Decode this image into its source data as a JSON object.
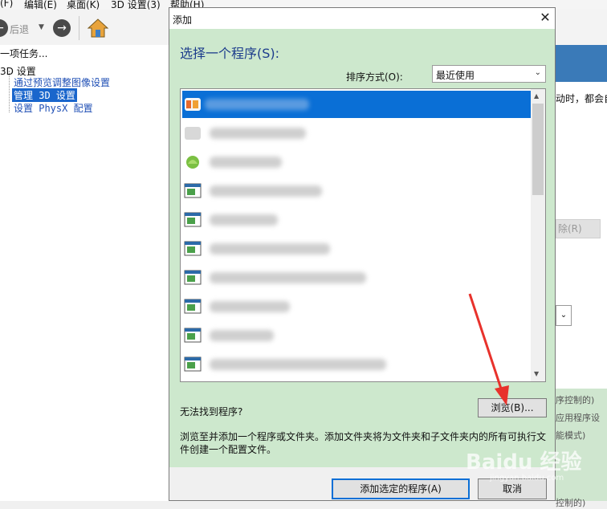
{
  "menubar": {
    "items": [
      "(F)",
      "编辑(E)",
      "桌面(K)",
      "3D 设置(3)",
      "帮助(H)"
    ]
  },
  "toolbar": {
    "back_label": "后退",
    "back_icon": "back-arrow-icon",
    "forward_icon": "forward-arrow-icon",
    "home_icon": "home-icon"
  },
  "task_panel": {
    "header": "一项任务..."
  },
  "tree": {
    "root": "3D 设置",
    "items": [
      "通过预览调整图像设置",
      "管理 3D 设置",
      "设置 PhysX 配置"
    ]
  },
  "right_panel": {
    "text1": "动时，都会自",
    "remove_button": "除(R)",
    "lines": [
      "序控制的)",
      "应用程序设",
      "能模式)",
      "控制的)"
    ]
  },
  "dialog": {
    "title": "添加",
    "heading": "选择一个程序(S):",
    "sort_label": "排序方式(O):",
    "sort_value": "最近使用",
    "not_found": "无法找到程序?",
    "browse_button": "浏览(B)...",
    "description": "浏览至并添加一个程序或文件夹。添加文件夹将为文件夹和子文件夹内的所有可执行文件创建一个配置文件。",
    "add_button": "添加选定的程序(A)",
    "cancel_button": "取消",
    "programs": [
      {
        "name": "",
        "icon": "app-icon-orange",
        "selected": true
      },
      {
        "name": "",
        "icon": "app-icon-blurred",
        "selected": false
      },
      {
        "name": "",
        "icon": "app-icon-green",
        "selected": false
      },
      {
        "name": "",
        "icon": "program-window-icon",
        "selected": false
      },
      {
        "name": "",
        "icon": "program-window-icon",
        "selected": false
      },
      {
        "name": "",
        "icon": "program-window-icon",
        "selected": false
      },
      {
        "name": "",
        "icon": "program-window-icon",
        "selected": false
      },
      {
        "name": "",
        "icon": "program-window-icon",
        "selected": false
      },
      {
        "name": "",
        "icon": "program-window-icon",
        "selected": false
      },
      {
        "name": "",
        "icon": "program-window-icon",
        "selected": false
      }
    ]
  },
  "watermark": {
    "text": "Baidu 经验",
    "sub": "jingyan.baidu.com"
  },
  "colors": {
    "dialog_bg": "#cde8cd",
    "selection": "#0a6fd6",
    "annotation_arrow": "#e8322c"
  }
}
